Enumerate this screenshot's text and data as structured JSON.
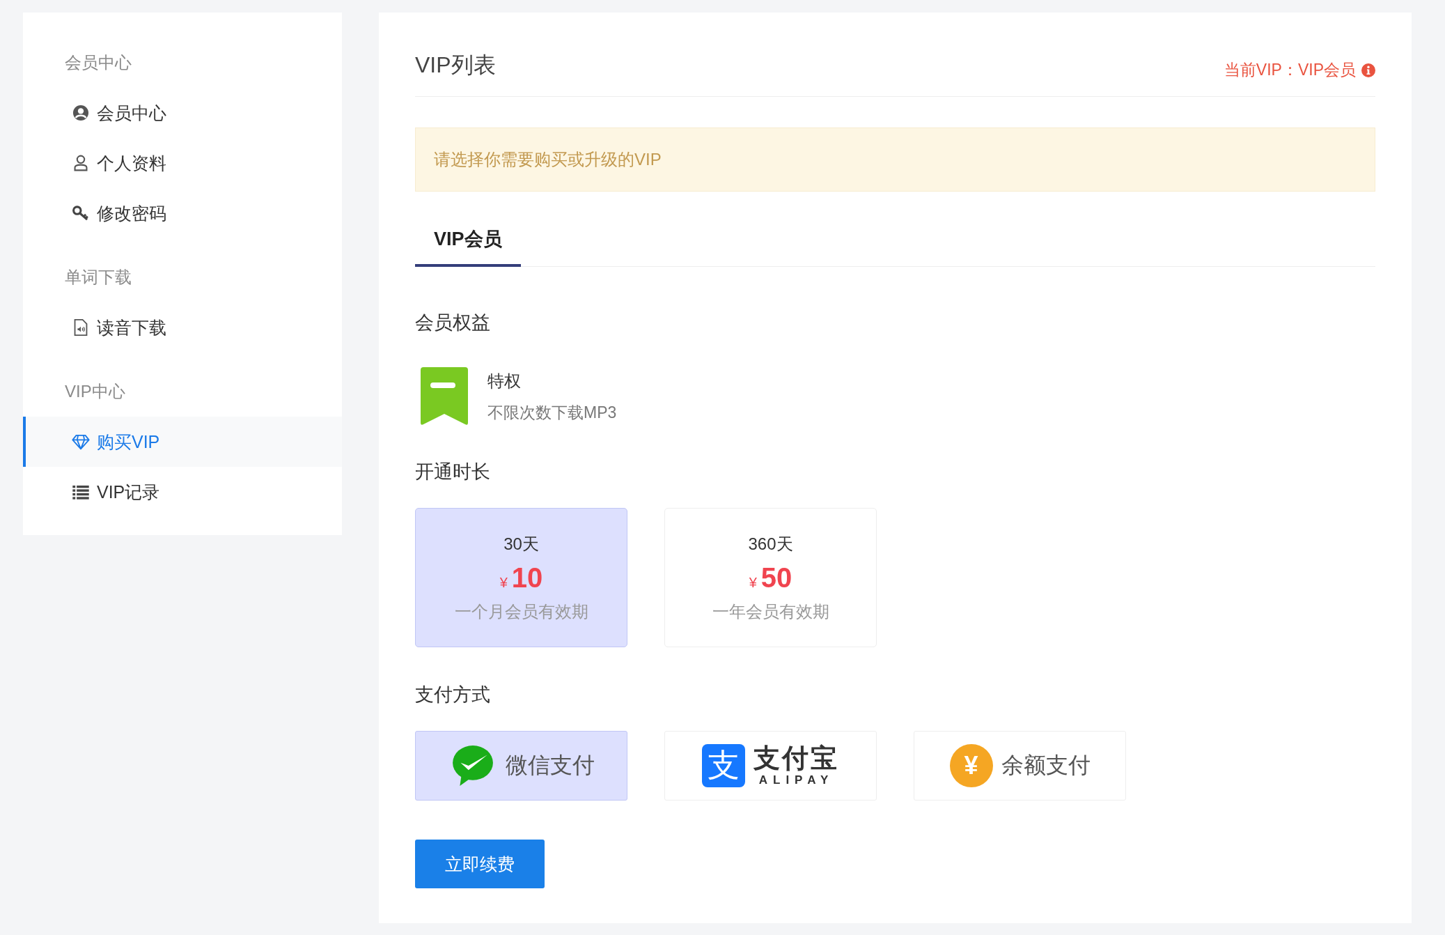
{
  "sidebar": {
    "sections": [
      {
        "title": "会员中心",
        "items": [
          {
            "label": "会员中心",
            "kind": "profile",
            "selected": false
          },
          {
            "label": "个人资料",
            "kind": "user",
            "selected": false
          },
          {
            "label": "修改密码",
            "kind": "key",
            "selected": false
          }
        ]
      },
      {
        "title": "单词下载",
        "items": [
          {
            "label": "读音下载",
            "kind": "audio",
            "selected": false
          }
        ]
      },
      {
        "title": "VIP中心",
        "items": [
          {
            "label": "购买VIP",
            "kind": "diamond",
            "selected": true
          },
          {
            "label": "VIP记录",
            "kind": "list",
            "selected": false
          }
        ]
      }
    ]
  },
  "main": {
    "title": "VIP列表",
    "current_vip": "当前VIP：VIP会员",
    "alert": "请选择你需要购买或升级的VIP",
    "tabs": [
      {
        "label": "VIP会员",
        "selected": true
      }
    ],
    "benefits": {
      "heading": "会员权益",
      "items": [
        {
          "title": "特权",
          "description": "不限次数下载MP3"
        }
      ]
    },
    "plans": {
      "heading": "开通时长",
      "items": [
        {
          "duration": "30天",
          "currency": "¥",
          "price": "10",
          "note": "一个月会员有效期",
          "selected": true
        },
        {
          "duration": "360天",
          "currency": "¥",
          "price": "50",
          "note": "一年会员有效期",
          "selected": false
        }
      ]
    },
    "payment": {
      "heading": "支付方式",
      "methods": [
        {
          "kind": "wechat",
          "label": "微信支付",
          "selected": true
        },
        {
          "kind": "alipay",
          "mark": "支",
          "label": "支付宝",
          "sublabel": "ALIPAY",
          "selected": false
        },
        {
          "kind": "balance",
          "mark": "¥",
          "label": "余额支付",
          "selected": false
        }
      ]
    },
    "submit": "立即续费"
  }
}
